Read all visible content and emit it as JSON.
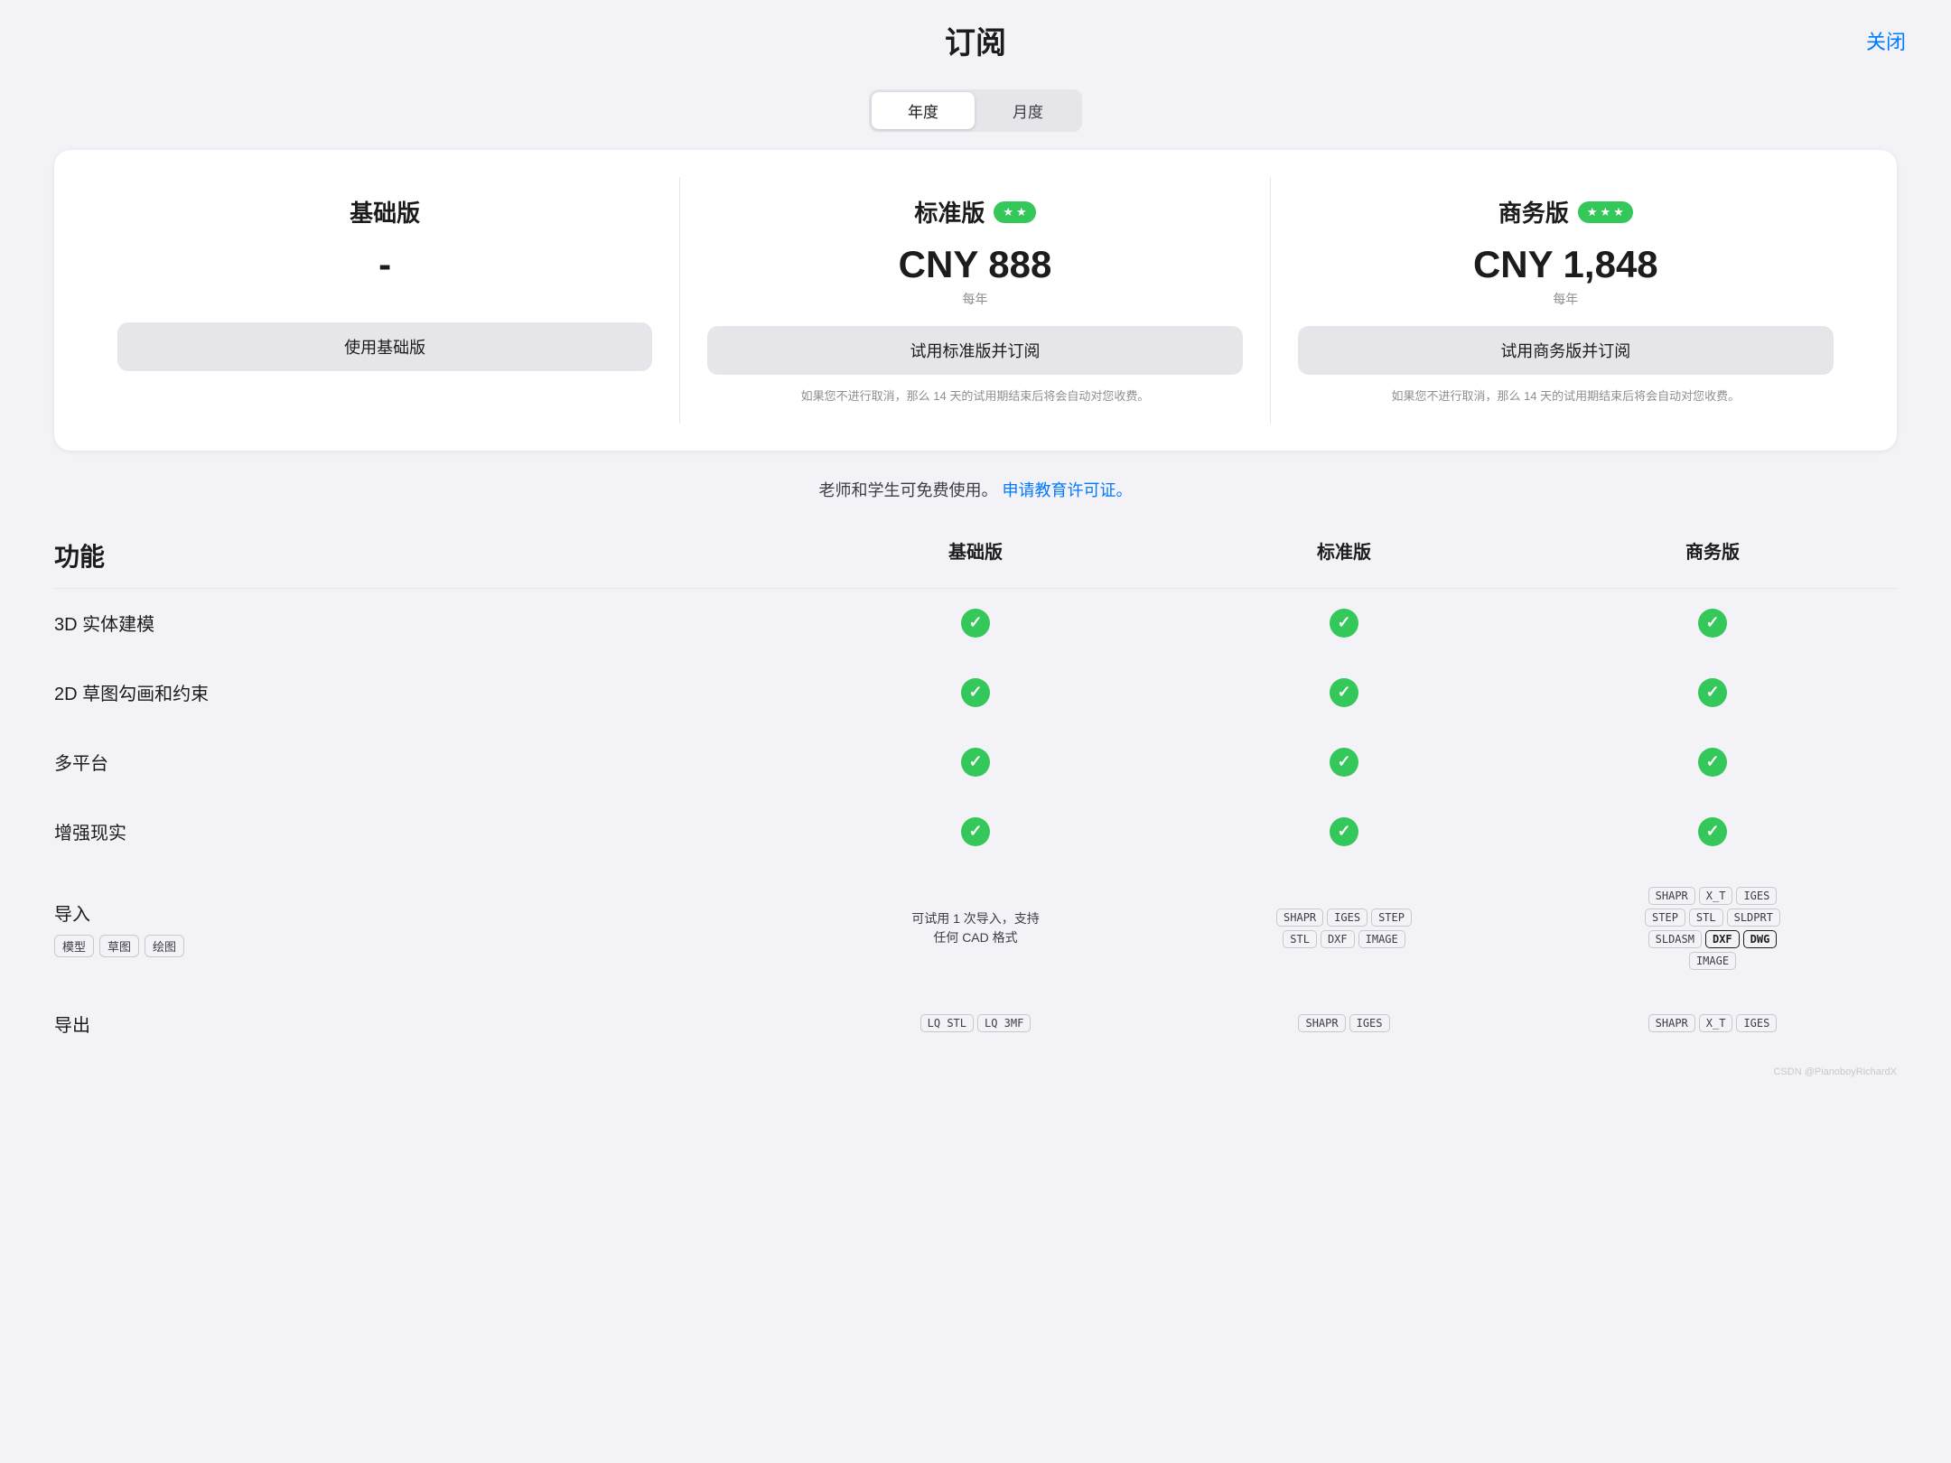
{
  "header": {
    "title": "订阅",
    "close_label": "关闭"
  },
  "toggle": {
    "options": [
      "年度",
      "月度"
    ],
    "active_index": 0
  },
  "plans": [
    {
      "id": "basic",
      "name": "基础版",
      "badge": null,
      "price": "-",
      "period": "",
      "btn_label": "使用基础版",
      "note": ""
    },
    {
      "id": "standard",
      "name": "标准版",
      "badge": "★★",
      "price": "CNY 888",
      "period": "每年",
      "btn_label": "试用标准版并订阅",
      "note": "如果您不进行取消，那么 14 天的试用期结束后将会自动对您收费。"
    },
    {
      "id": "business",
      "name": "商务版",
      "badge": "★★★",
      "price": "CNY 1,848",
      "period": "每年",
      "btn_label": "试用商务版并订阅",
      "note": "如果您不进行取消，那么 14 天的试用期结束后将会自动对您收费。"
    }
  ],
  "edu_notice": {
    "text": "老师和学生可免费使用。",
    "link_text": "申请教育许可证。"
  },
  "features_section": {
    "title": "功能",
    "col_headers": [
      "基础版",
      "标准版",
      "商务版"
    ],
    "rows": [
      {
        "name": "3D 实体建模",
        "tags": [],
        "basic": "check",
        "standard": "check",
        "business": "check"
      },
      {
        "name": "2D 草图勾画和约束",
        "tags": [],
        "basic": "check",
        "standard": "check",
        "business": "check"
      },
      {
        "name": "多平台",
        "tags": [],
        "basic": "check",
        "standard": "check",
        "business": "check"
      },
      {
        "name": "增强现实",
        "tags": [],
        "basic": "check",
        "standard": "check",
        "business": "check"
      },
      {
        "name": "导入",
        "tags": [
          "模型",
          "草图",
          "绘图"
        ],
        "basic": "text:可试用 1 次导入，支持\n任何 CAD 格式",
        "standard": "tags:SHAPR|IGES|STEP|STL|DXF|IMAGE",
        "business": "tags:SHAPR|X_T|IGES|STEP|STL|SLDPRT|SLDASM|DXF*|DWG*|IMAGE"
      },
      {
        "name": "导出",
        "tags": [],
        "basic": "tags:LQ STL|LQ 3MF",
        "standard": "tags:SHAPR|IGES",
        "business": "tags:SHAPR|X_T|IGES"
      }
    ]
  },
  "watermark": "CSDN @PianoboyRichardX"
}
